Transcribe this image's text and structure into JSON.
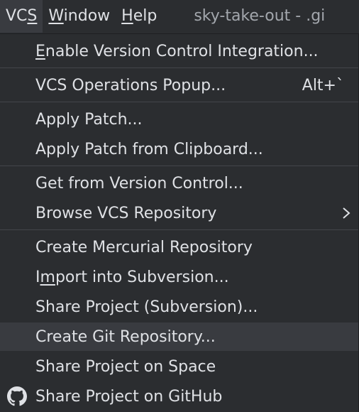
{
  "menubar": {
    "vcs_pre": "VC",
    "vcs_mnemonic": "S",
    "window_mnemonic": "W",
    "window_post": "indow",
    "help_mnemonic": "H",
    "help_post": "elp",
    "title": "sky-take-out - .gi"
  },
  "menu": {
    "enable_vcs_mnemonic": "E",
    "enable_vcs_post": "nable Version Control Integration...",
    "vcs_ops_label": "VCS Operations Popup...",
    "vcs_ops_shortcut": "Alt+`",
    "apply_patch": "Apply Patch...",
    "apply_patch_clipboard": "Apply Patch from Clipboard...",
    "get_from_vc": "Get from Version Control...",
    "browse_vcs": "Browse VCS Repository",
    "create_mercurial": "Create Mercurial Repository",
    "import_svn_pre": "I",
    "import_svn_mnemonic": "m",
    "import_svn_post": "port into Subversion...",
    "share_svn": "Share Project (Subversion)...",
    "create_git": "Create Git Repository...",
    "share_space": "Share Project on Space",
    "share_github": "Share Project on GitHub"
  },
  "icons": {
    "submenu": "chevron-right-icon",
    "github": "github-icon"
  },
  "colors": {
    "background": "#2b2d30",
    "highlight": "#393b40",
    "text": "#dfe1e5",
    "title_text": "#a3a7ad",
    "separator": "#43454a"
  }
}
